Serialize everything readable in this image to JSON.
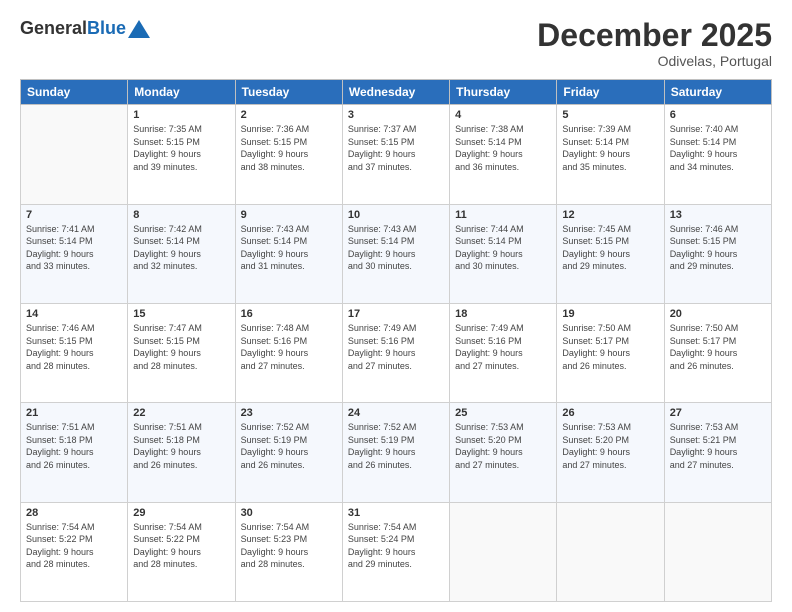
{
  "header": {
    "logo_general": "General",
    "logo_blue": "Blue",
    "month_title": "December 2025",
    "location": "Odivelas, Portugal"
  },
  "days_of_week": [
    "Sunday",
    "Monday",
    "Tuesday",
    "Wednesday",
    "Thursday",
    "Friday",
    "Saturday"
  ],
  "weeks": [
    [
      {
        "day": "",
        "info": ""
      },
      {
        "day": "1",
        "info": "Sunrise: 7:35 AM\nSunset: 5:15 PM\nDaylight: 9 hours\nand 39 minutes."
      },
      {
        "day": "2",
        "info": "Sunrise: 7:36 AM\nSunset: 5:15 PM\nDaylight: 9 hours\nand 38 minutes."
      },
      {
        "day": "3",
        "info": "Sunrise: 7:37 AM\nSunset: 5:15 PM\nDaylight: 9 hours\nand 37 minutes."
      },
      {
        "day": "4",
        "info": "Sunrise: 7:38 AM\nSunset: 5:14 PM\nDaylight: 9 hours\nand 36 minutes."
      },
      {
        "day": "5",
        "info": "Sunrise: 7:39 AM\nSunset: 5:14 PM\nDaylight: 9 hours\nand 35 minutes."
      },
      {
        "day": "6",
        "info": "Sunrise: 7:40 AM\nSunset: 5:14 PM\nDaylight: 9 hours\nand 34 minutes."
      }
    ],
    [
      {
        "day": "7",
        "info": "Sunrise: 7:41 AM\nSunset: 5:14 PM\nDaylight: 9 hours\nand 33 minutes."
      },
      {
        "day": "8",
        "info": "Sunrise: 7:42 AM\nSunset: 5:14 PM\nDaylight: 9 hours\nand 32 minutes."
      },
      {
        "day": "9",
        "info": "Sunrise: 7:43 AM\nSunset: 5:14 PM\nDaylight: 9 hours\nand 31 minutes."
      },
      {
        "day": "10",
        "info": "Sunrise: 7:43 AM\nSunset: 5:14 PM\nDaylight: 9 hours\nand 30 minutes."
      },
      {
        "day": "11",
        "info": "Sunrise: 7:44 AM\nSunset: 5:14 PM\nDaylight: 9 hours\nand 30 minutes."
      },
      {
        "day": "12",
        "info": "Sunrise: 7:45 AM\nSunset: 5:15 PM\nDaylight: 9 hours\nand 29 minutes."
      },
      {
        "day": "13",
        "info": "Sunrise: 7:46 AM\nSunset: 5:15 PM\nDaylight: 9 hours\nand 29 minutes."
      }
    ],
    [
      {
        "day": "14",
        "info": "Sunrise: 7:46 AM\nSunset: 5:15 PM\nDaylight: 9 hours\nand 28 minutes."
      },
      {
        "day": "15",
        "info": "Sunrise: 7:47 AM\nSunset: 5:15 PM\nDaylight: 9 hours\nand 28 minutes."
      },
      {
        "day": "16",
        "info": "Sunrise: 7:48 AM\nSunset: 5:16 PM\nDaylight: 9 hours\nand 27 minutes."
      },
      {
        "day": "17",
        "info": "Sunrise: 7:49 AM\nSunset: 5:16 PM\nDaylight: 9 hours\nand 27 minutes."
      },
      {
        "day": "18",
        "info": "Sunrise: 7:49 AM\nSunset: 5:16 PM\nDaylight: 9 hours\nand 27 minutes."
      },
      {
        "day": "19",
        "info": "Sunrise: 7:50 AM\nSunset: 5:17 PM\nDaylight: 9 hours\nand 26 minutes."
      },
      {
        "day": "20",
        "info": "Sunrise: 7:50 AM\nSunset: 5:17 PM\nDaylight: 9 hours\nand 26 minutes."
      }
    ],
    [
      {
        "day": "21",
        "info": "Sunrise: 7:51 AM\nSunset: 5:18 PM\nDaylight: 9 hours\nand 26 minutes."
      },
      {
        "day": "22",
        "info": "Sunrise: 7:51 AM\nSunset: 5:18 PM\nDaylight: 9 hours\nand 26 minutes."
      },
      {
        "day": "23",
        "info": "Sunrise: 7:52 AM\nSunset: 5:19 PM\nDaylight: 9 hours\nand 26 minutes."
      },
      {
        "day": "24",
        "info": "Sunrise: 7:52 AM\nSunset: 5:19 PM\nDaylight: 9 hours\nand 26 minutes."
      },
      {
        "day": "25",
        "info": "Sunrise: 7:53 AM\nSunset: 5:20 PM\nDaylight: 9 hours\nand 27 minutes."
      },
      {
        "day": "26",
        "info": "Sunrise: 7:53 AM\nSunset: 5:20 PM\nDaylight: 9 hours\nand 27 minutes."
      },
      {
        "day": "27",
        "info": "Sunrise: 7:53 AM\nSunset: 5:21 PM\nDaylight: 9 hours\nand 27 minutes."
      }
    ],
    [
      {
        "day": "28",
        "info": "Sunrise: 7:54 AM\nSunset: 5:22 PM\nDaylight: 9 hours\nand 28 minutes."
      },
      {
        "day": "29",
        "info": "Sunrise: 7:54 AM\nSunset: 5:22 PM\nDaylight: 9 hours\nand 28 minutes."
      },
      {
        "day": "30",
        "info": "Sunrise: 7:54 AM\nSunset: 5:23 PM\nDaylight: 9 hours\nand 28 minutes."
      },
      {
        "day": "31",
        "info": "Sunrise: 7:54 AM\nSunset: 5:24 PM\nDaylight: 9 hours\nand 29 minutes."
      },
      {
        "day": "",
        "info": ""
      },
      {
        "day": "",
        "info": ""
      },
      {
        "day": "",
        "info": ""
      }
    ]
  ]
}
